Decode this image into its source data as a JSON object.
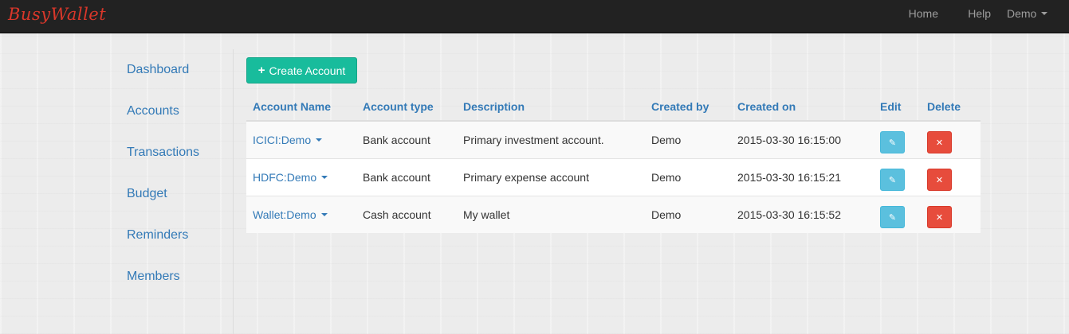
{
  "brand": "BusyWallet",
  "nav": {
    "home": "Home",
    "help": "Help",
    "user": "Demo"
  },
  "sidebar": {
    "items": [
      {
        "label": "Dashboard"
      },
      {
        "label": "Accounts"
      },
      {
        "label": "Transactions"
      },
      {
        "label": "Budget"
      },
      {
        "label": "Reminders"
      },
      {
        "label": "Members"
      }
    ]
  },
  "actions": {
    "create_label": "Create Account",
    "create_icon": "plus-icon"
  },
  "table": {
    "headers": [
      "Account Name",
      "Account type",
      "Description",
      "Created by",
      "Created on",
      "Edit",
      "Delete"
    ],
    "rows": [
      {
        "name": "ICICI:Demo",
        "type": "Bank account",
        "description": "Primary investment account.",
        "created_by": "Demo",
        "created_on": "2015-03-30 16:15:00"
      },
      {
        "name": "HDFC:Demo",
        "type": "Bank account",
        "description": "Primary expense account",
        "created_by": "Demo",
        "created_on": "2015-03-30 16:15:21"
      },
      {
        "name": "Wallet:Demo",
        "type": "Cash account",
        "description": "My wallet",
        "created_by": "Demo",
        "created_on": "2015-03-30 16:15:52"
      }
    ]
  },
  "colors": {
    "accent": "#18bc9c",
    "link": "#337ab7",
    "edit": "#5bc0de",
    "delete": "#e74c3c",
    "navbar": "#222222",
    "brand": "#d9372a"
  }
}
